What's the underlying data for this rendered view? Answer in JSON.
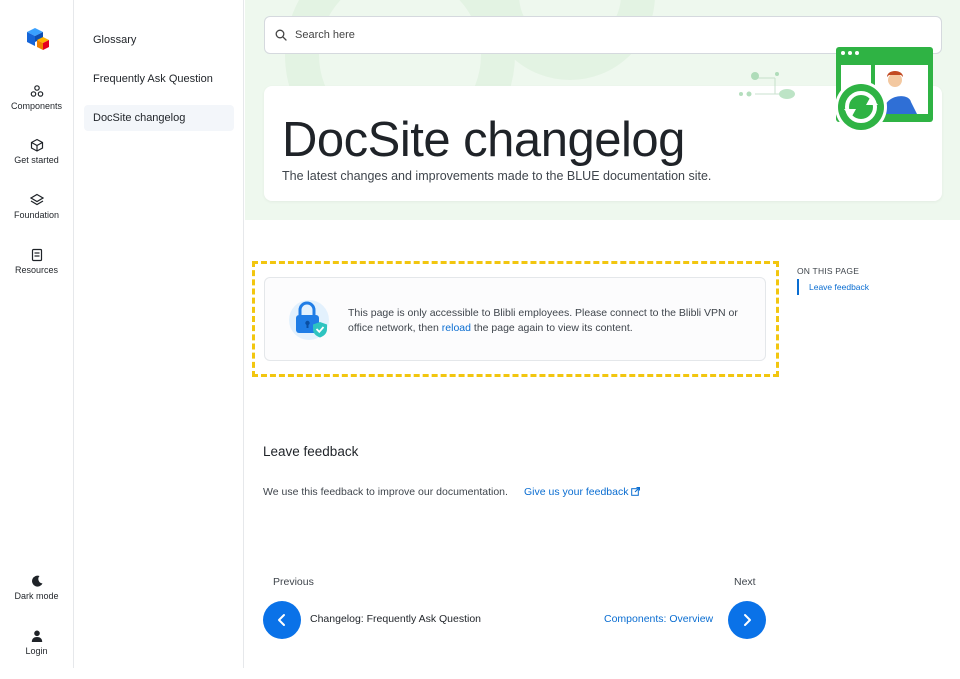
{
  "rail": {
    "items": [
      {
        "label": "Components",
        "icon": "components-icon"
      },
      {
        "label": "Get started",
        "icon": "cube-icon"
      },
      {
        "label": "Foundation",
        "icon": "layers-icon"
      },
      {
        "label": "Resources",
        "icon": "book-icon"
      }
    ],
    "dark_mode": "Dark mode",
    "login": "Login"
  },
  "subnav": {
    "items": [
      "Glossary",
      "Frequently Ask Question",
      "DocSite changelog"
    ],
    "active": "DocSite changelog"
  },
  "search": {
    "placeholder": "Search here"
  },
  "header": {
    "title": "DocSite changelog",
    "subtitle": "The latest changes and improvements made to the BLUE documentation site."
  },
  "notice": {
    "text_before": "This page is only accessible to Blibli employees. Please connect to the Blibli VPN or office network, then ",
    "link": "reload",
    "text_after": " the page again to view its content."
  },
  "toc": {
    "title": "ON THIS PAGE",
    "items": [
      "Leave feedback"
    ]
  },
  "feedback": {
    "heading": "Leave feedback",
    "text": "We use this feedback to improve our documentation.",
    "link": "Give us your feedback"
  },
  "pager": {
    "previous_label": "Previous",
    "previous_title": "Changelog: Frequently Ask Question",
    "next_label": "Next",
    "next_title": "Components: Overview"
  },
  "colors": {
    "accent": "#0a72e8",
    "link": "#0a6dd1",
    "notice_outline": "#f2c60f",
    "hero_bg": "#eef8ee",
    "illustration_green": "#2fb344"
  }
}
